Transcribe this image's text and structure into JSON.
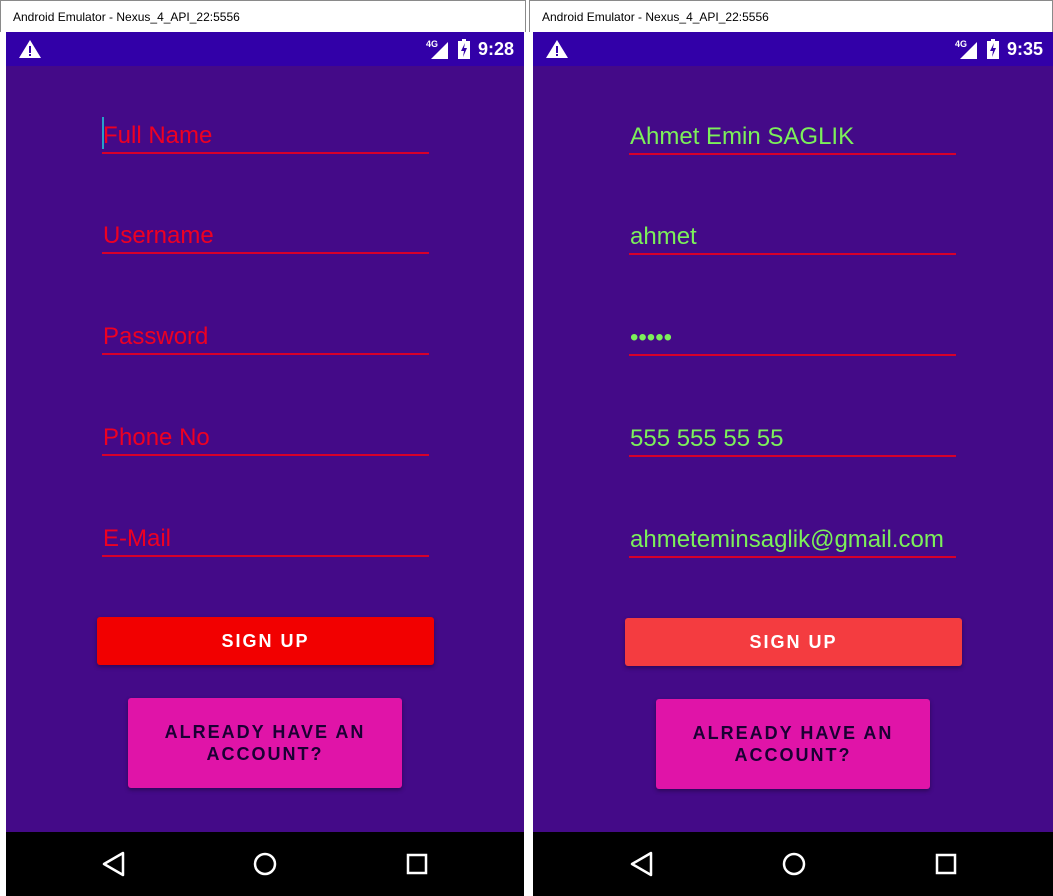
{
  "left": {
    "window_title": "Android Emulator - Nexus_4_API_22:5556",
    "status": {
      "network": "4G",
      "time": "9:28"
    },
    "fields": {
      "full_name": "Full Name",
      "username": "Username",
      "password": "Password",
      "phone": "Phone No",
      "email": "E-Mail"
    },
    "signup_label": "SIGN UP",
    "already_label": "ALREADY HAVE AN ACCOUNT?"
  },
  "right": {
    "window_title": "Android Emulator - Nexus_4_API_22:5556",
    "status": {
      "network": "4G",
      "time": "9:35"
    },
    "fields": {
      "full_name": "Ahmet Emin SAGLIK",
      "username": "ahmet",
      "password": "•••••",
      "phone": "555 555 55 55",
      "email": "ahmeteminsaglik@gmail.com"
    },
    "signup_label": "SIGN UP",
    "already_label": "ALREADY HAVE AN ACCOUNT?"
  },
  "icons": {
    "status_warning": "warning-icon",
    "signal": "signal-icon",
    "battery": "battery-icon",
    "back": "back-icon",
    "home": "home-icon",
    "recents": "recents-icon"
  },
  "colors": {
    "screen_background": "#440a88",
    "status_bar": "#3200a8",
    "placeholder_text": "#ee0022",
    "entered_text": "#7cf05a",
    "field_underline": "#d8002a",
    "signup_button_left": "#f20000",
    "signup_button_right": "#f43c40",
    "already_button": "#e014a8"
  }
}
